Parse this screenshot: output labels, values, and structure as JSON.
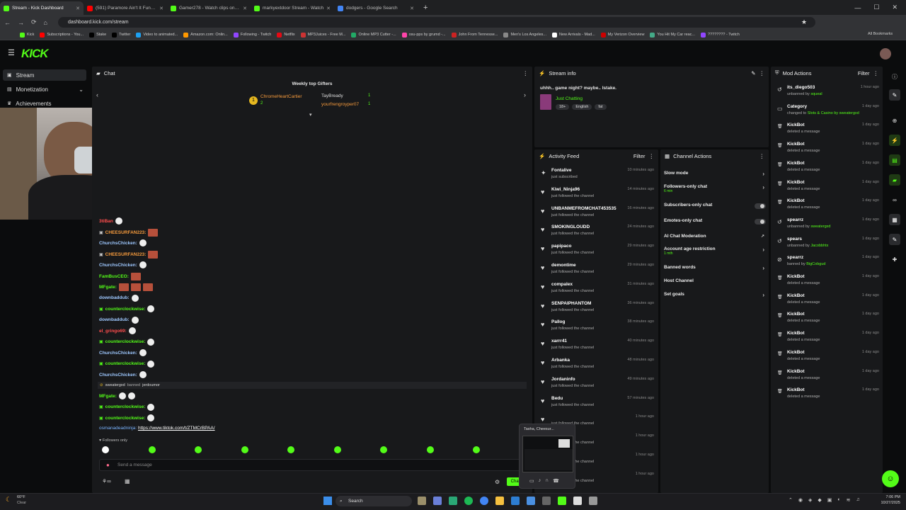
{
  "browser": {
    "tabs": [
      {
        "title": "Stream - Kick Dashboard",
        "color": "#53fc18",
        "active": true
      },
      {
        "title": "(591) Paramore Ain't It Fun [O",
        "color": "#ff0000"
      },
      {
        "title": "Gamer278 - Watch clips on Kick",
        "color": "#53fc18"
      },
      {
        "title": "markyextdoor Stream - Watch",
        "color": "#53fc18"
      },
      {
        "title": "dodgers - Google Search",
        "color": "#4285f4"
      }
    ],
    "url": "dashboard.kick.com/stream",
    "bookmarks": [
      "Kick",
      "Subscriptions - You...",
      "Stake",
      "Twitter",
      "Video to animated...",
      "Amazon.com: Onlin...",
      "Following - Twitch",
      "Netflix",
      "MP3Juices - Free M...",
      "Online MP3 Cutter -...",
      "osu-pps by grumd -...",
      "John From Tennesse...",
      "Men's Los Angeles...",
      "New Arrivals - Mad...",
      "My Verizon Overview",
      "You Hit My Car reac...",
      "???????? - Twitch"
    ],
    "all_bookmarks": "All Bookmarks"
  },
  "brand": "KICK",
  "sidebar": {
    "items": [
      {
        "label": "Stream"
      },
      {
        "label": "Monetization"
      },
      {
        "label": "Achievements"
      }
    ]
  },
  "chat": {
    "title": "Chat",
    "gifters_title": "Weekly top Gifters",
    "gifters": [
      {
        "name": "ChromeHeartCartier",
        "count": "2"
      },
      {
        "name": "TayBready",
        "count": "1"
      },
      {
        "name": "yourfrengroyper07",
        "count": "1"
      }
    ],
    "messages": [
      {
        "user": "3tiBan",
        "color": "#ff4d4d",
        "emotes": 1
      },
      {
        "user": "CHEESURFAN223:",
        "color": "#f59a3c",
        "badge": true,
        "emotes": 0,
        "sq": 1
      },
      {
        "user": "ChurchsChicken:",
        "color": "#9ec8ff",
        "emotes": 1
      },
      {
        "user": "CHEESURFAN223:",
        "color": "#f59a3c",
        "badge": true,
        "emotes": 0,
        "sq": 1
      },
      {
        "user": "ChurchsChicken:",
        "color": "#9ec8ff",
        "emotes": 1
      },
      {
        "user": "FamBusCEO:",
        "color": "#53fc18",
        "emotes": 0,
        "sq": 1
      },
      {
        "user": "MFgate:",
        "color": "#53fc18",
        "emotes": 0,
        "sq": 3
      },
      {
        "user": "downbaddub:",
        "color": "#9ec8ff",
        "emotes": 1
      },
      {
        "user": "counterclockwise:",
        "color": "#53fc18",
        "badge": true,
        "emotes": 1
      },
      {
        "user": "downbaddub:",
        "color": "#9ec8ff",
        "emotes": 1
      },
      {
        "user": "el_gringo69:",
        "color": "#ff4d4d",
        "emotes": 1
      },
      {
        "user": "counterclockwise:",
        "color": "#53fc18",
        "badge": true,
        "emotes": 1
      },
      {
        "user": "ChurchsChicken:",
        "color": "#9ec8ff",
        "emotes": 1
      },
      {
        "user": "counterclockwise:",
        "color": "#53fc18",
        "badge": true,
        "emotes": 1
      },
      {
        "user": "ChurchsChicken:",
        "color": "#9ec8ff",
        "emotes": 1
      }
    ],
    "ban_notice": {
      "moderator": "sweatergxd",
      "text": "banned",
      "target": "jerdoumor"
    },
    "messages2": [
      {
        "user": "MFgate:",
        "color": "#53fc18",
        "emotes": 2
      },
      {
        "user": "counterclockwise:",
        "color": "#53fc18",
        "badge": true,
        "emotes": 1
      },
      {
        "user": "counterclockwise:",
        "color": "#53fc18",
        "badge": true,
        "emotes": 1
      }
    ],
    "link_msg": {
      "user": "osmanadeadninja:",
      "link": "https://www.tiktok.com/t/ZTMCrBPAA/"
    },
    "followers_only": "Followers only",
    "input_placeholder": "Send a message",
    "send_label": "Chat"
  },
  "stream_info": {
    "title": "Stream info",
    "stream_title": "uhhh.. game night? maybe.. Istake.",
    "category": "Just Chatting",
    "tags": [
      "18+",
      "English",
      "fat"
    ]
  },
  "activity": {
    "title": "Activity Feed",
    "filter": "Filter",
    "items": [
      {
        "name": "Fontalive",
        "sub": "just subscribed",
        "time": "10 minutes ago",
        "icon": "star"
      },
      {
        "name": "Kiwi_Ninja96",
        "sub": "just followed the channel",
        "time": "14 minutes ago",
        "icon": "heart"
      },
      {
        "name": "UNBANMEFROMCHAT453535",
        "sub": "just followed the channel",
        "time": "16 minutes ago",
        "icon": "heart"
      },
      {
        "name": "SMOKINGLOUDD",
        "sub": "just followed the channel",
        "time": "24 minutes ago",
        "icon": "heart"
      },
      {
        "name": "papipaco",
        "sub": "just followed the channel",
        "time": "29 minutes ago",
        "icon": "heart"
      },
      {
        "name": "demontime",
        "sub": "just followed the channel",
        "time": "29 minutes ago",
        "icon": "heart"
      },
      {
        "name": "compalex",
        "sub": "just followed the channel",
        "time": "31 minutes ago",
        "icon": "heart"
      },
      {
        "name": "SENPAIPHANTOM",
        "sub": "just followed the channel",
        "time": "36 minutes ago",
        "icon": "heart"
      },
      {
        "name": "Pallog",
        "sub": "just followed the channel",
        "time": "38 minutes ago",
        "icon": "heart"
      },
      {
        "name": "xarrr41",
        "sub": "just followed the channel",
        "time": "40 minutes ago",
        "icon": "heart"
      },
      {
        "name": "Arbanka",
        "sub": "just followed the channel",
        "time": "48 minutes ago",
        "icon": "heart"
      },
      {
        "name": "Jordaninfo",
        "sub": "just followed the channel",
        "time": "49 minutes ago",
        "icon": "heart"
      },
      {
        "name": "Bedu",
        "sub": "just followed the channel",
        "time": "57 minutes ago",
        "icon": "heart"
      },
      {
        "name": "",
        "sub": "just followed the channel",
        "time": "1 hour ago",
        "icon": "heart"
      },
      {
        "name": "",
        "sub": "just followed the channel",
        "time": "1 hour ago",
        "icon": "heart"
      },
      {
        "name": "",
        "sub": "just followed the channel",
        "time": "1 hour ago",
        "icon": "heart"
      },
      {
        "name": "",
        "sub": "just followed the channel",
        "time": "1 hour ago",
        "icon": "heart"
      }
    ]
  },
  "channel_actions": {
    "title": "Channel Actions",
    "items": [
      {
        "label": "Slow mode",
        "kind": "chevron"
      },
      {
        "label": "Followers-only chat",
        "sub": "6 min",
        "kind": "chevron"
      },
      {
        "label": "Subscribers-only chat",
        "kind": "toggle"
      },
      {
        "label": "Emotes-only chat",
        "kind": "toggle"
      },
      {
        "label": "AI Chat Moderation",
        "kind": "link"
      },
      {
        "label": "Account age restriction",
        "sub": "1 mth",
        "kind": "chevron"
      },
      {
        "label": "Banned words",
        "kind": "chevron"
      },
      {
        "label": "Host Channel",
        "kind": "none"
      },
      {
        "label": "Set goals",
        "kind": "chevron"
      }
    ]
  },
  "mod_actions": {
    "title": "Mod Actions",
    "filter": "Filter",
    "items": [
      {
        "name": "its_diego503",
        "sub": "unbanned by",
        "by": "squeal",
        "time": "1 hour ago",
        "icon": "undo"
      },
      {
        "name": "Category",
        "sub": "changed to",
        "by": "Slots & Casino by sweatergxd",
        "time": "1 day ago",
        "icon": "tv"
      },
      {
        "name": "KickBot",
        "sub": "deleted a message",
        "time": "1 day ago",
        "icon": "trash"
      },
      {
        "name": "KickBot",
        "sub": "deleted a message",
        "time": "1 day ago",
        "icon": "trash"
      },
      {
        "name": "KickBot",
        "sub": "deleted a message",
        "time": "1 day ago",
        "icon": "trash"
      },
      {
        "name": "KickBot",
        "sub": "deleted a message",
        "time": "1 day ago",
        "icon": "trash"
      },
      {
        "name": "KickBot",
        "sub": "deleted a message",
        "time": "1 day ago",
        "icon": "trash"
      },
      {
        "name": "spearrz",
        "sub": "unbanned by",
        "by": "sweatergxd",
        "time": "1 day ago",
        "icon": "undo"
      },
      {
        "name": "spears",
        "sub": "unbanned by",
        "by": "Jacobbhtx",
        "time": "1 day ago",
        "icon": "undo"
      },
      {
        "name": "spearrz",
        "sub": "banned by",
        "by": "BigCobgud",
        "time": "1 day ago",
        "icon": "ban"
      },
      {
        "name": "KickBot",
        "sub": "deleted a message",
        "time": "1 day ago",
        "icon": "trash"
      },
      {
        "name": "KickBot",
        "sub": "deleted a message",
        "time": "1 day ago",
        "icon": "trash"
      },
      {
        "name": "KickBot",
        "sub": "deleted a message",
        "time": "1 day ago",
        "icon": "trash"
      },
      {
        "name": "KickBot",
        "sub": "deleted a message",
        "time": "1 day ago",
        "icon": "trash"
      },
      {
        "name": "KickBot",
        "sub": "deleted a message",
        "time": "1 day ago",
        "icon": "trash"
      },
      {
        "name": "KickBot",
        "sub": "deleted a message",
        "time": "1 day ago",
        "icon": "trash"
      },
      {
        "name": "KickBot",
        "sub": "deleted a message",
        "time": "1 day ago",
        "icon": "trash"
      }
    ]
  },
  "popup": {
    "title": "Tasha, Cheesur..."
  },
  "taskbar": {
    "weather_temp": "60°F",
    "weather_desc": "Clear",
    "search": "Search",
    "time": "7:06 PM",
    "date": "10/27/2025"
  },
  "colors": {
    "accent": "#53fc18",
    "panel": "#18191b",
    "bg": "#0b0c0d"
  }
}
